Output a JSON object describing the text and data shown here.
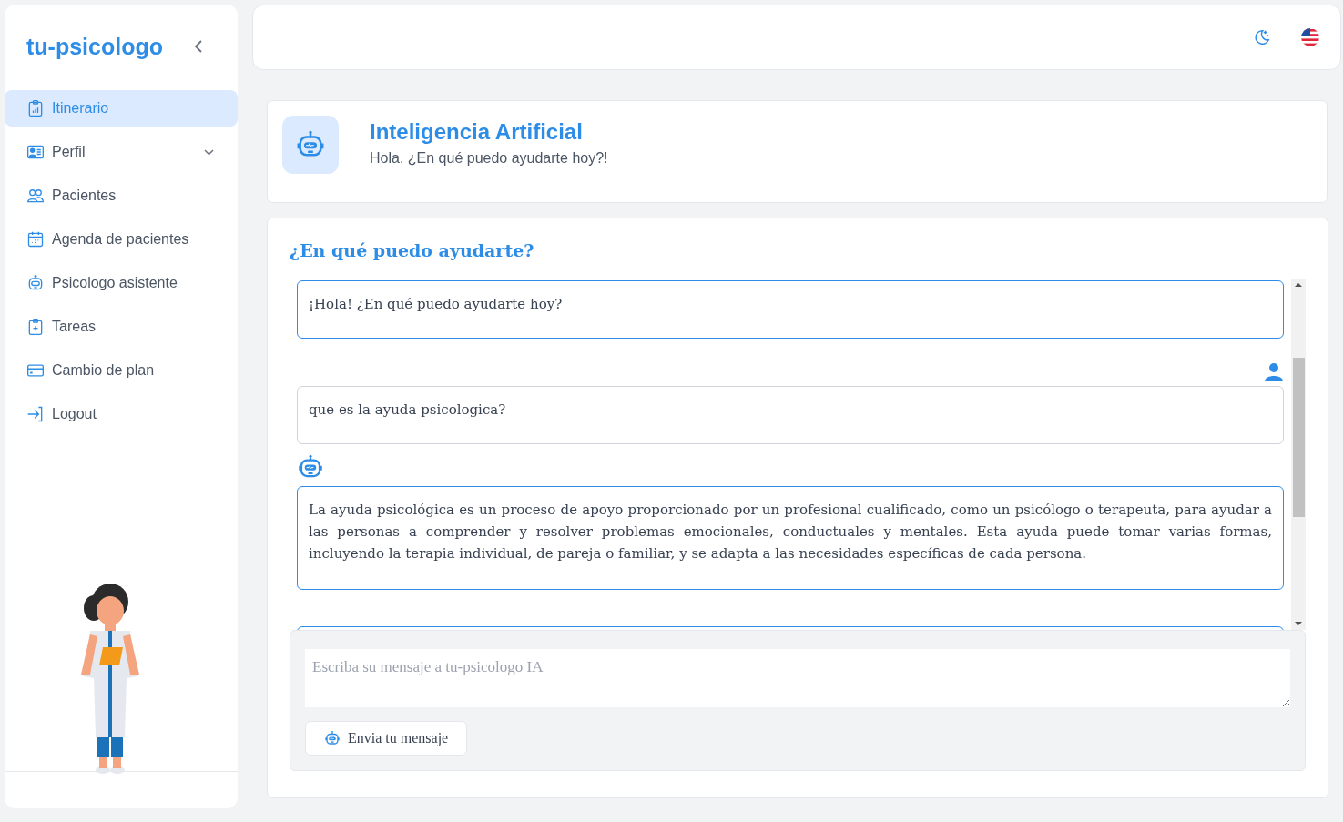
{
  "sidebar": {
    "brand": "tu-psicologo",
    "items": [
      {
        "label": "Itinerario",
        "kind": "clipboard-chart",
        "selected": true
      },
      {
        "label": "Perfil",
        "kind": "id-card",
        "selected": false,
        "expandable": true
      },
      {
        "label": "Pacientes",
        "kind": "users",
        "selected": false
      },
      {
        "label": "Agenda de pacientes",
        "kind": "calendar",
        "selected": false
      },
      {
        "label": "Psicologo asistente",
        "kind": "robot",
        "selected": false
      },
      {
        "label": "Tareas",
        "kind": "clipboard-plus",
        "selected": false
      },
      {
        "label": "Cambio de plan",
        "kind": "card",
        "selected": false
      },
      {
        "label": "Logout",
        "kind": "logout",
        "selected": false
      }
    ]
  },
  "header": {
    "title": "Inteligencia Artificial",
    "subtitle": "Hola. ¿En qué puedo ayudarte hoy?!"
  },
  "chat": {
    "title": "¿En qué puedo ayudarte?",
    "messages": [
      {
        "kind": "bot",
        "avatar": false,
        "text": "¡Hola! ¿En qué puedo ayudarte hoy?"
      },
      {
        "kind": "user",
        "avatar": true,
        "text": "que es la ayuda psicologica?"
      },
      {
        "kind": "bot",
        "avatar": true,
        "text": "La ayuda psicológica es un proceso de apoyo proporcionado por un profesional cualificado, como un psicólogo o terapeuta, para ayudar a las personas a comprender y resolver problemas emocionales, conductuales y mentales. Esta ayuda puede tomar varias formas, incluyendo la terapia individual, de pareja o familiar, y se adapta a las necesidades específicas de cada persona."
      },
      {
        "kind": "bot",
        "avatar": false
      }
    ],
    "input": {
      "placeholder": "Escriba su mensaje a tu-psicologo IA"
    },
    "send_button": "Envia tu mensaje"
  }
}
